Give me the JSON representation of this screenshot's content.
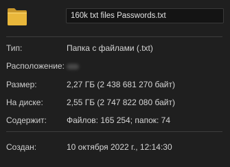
{
  "file": {
    "name": "160k txt files Passwords.txt"
  },
  "icon": "folder-icon",
  "properties": {
    "type": {
      "label": "Тип:",
      "value": "Папка с файлами (.txt)"
    },
    "location": {
      "label": "Расположение:",
      "value": ""
    },
    "size": {
      "label": "Размер:",
      "value": "2,27 ГБ (2 438 681 270 байт)"
    },
    "on_disk": {
      "label": "На диске:",
      "value": "2,55 ГБ (2 747 822 080 байт)"
    },
    "contains": {
      "label": "Содержит:",
      "value": "Файлов: 165 254; папок: 74"
    },
    "created": {
      "label": "Создан:",
      "value": "10 октября 2022 г., 12:14:30"
    }
  },
  "colors": {
    "background": "#1f1f1f",
    "folder_body": "#e9b73b",
    "folder_tab": "#c9982b",
    "text": "#d6d6d6"
  }
}
